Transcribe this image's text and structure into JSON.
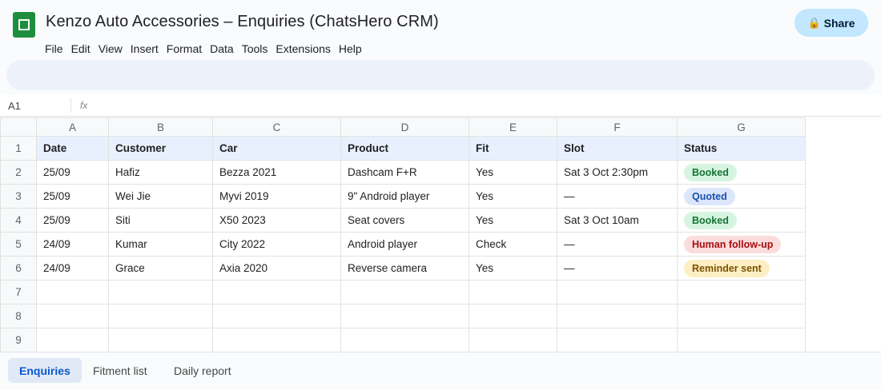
{
  "header": {
    "title": "Kenzo Auto Accessories – Enquiries (ChatsHero CRM)",
    "share_label": "Share",
    "share_icon": "lock-icon",
    "menu": [
      "File",
      "Edit",
      "View",
      "Insert",
      "Format",
      "Data",
      "Tools",
      "Extensions",
      "Help"
    ]
  },
  "formula_bar": {
    "cell_ref": "A1",
    "fx": "fx"
  },
  "grid": {
    "columns": [
      "A",
      "B",
      "C",
      "D",
      "E",
      "F",
      "G"
    ],
    "rows": [
      [
        "Date",
        "Customer",
        "Car",
        "Product",
        "Fit",
        "Slot",
        "Status"
      ],
      [
        "25/09",
        "Hafiz",
        "Bezza 2021",
        "Dashcam F+R",
        "Yes",
        "Sat 3 Oct 2:30pm",
        "Booked"
      ],
      [
        "25/09",
        "Wei Jie",
        "Myvi 2019",
        "9\" Android player",
        "Yes",
        "—",
        "Quoted"
      ],
      [
        "25/09",
        "Siti",
        "X50 2023",
        "Seat covers",
        "Yes",
        "Sat 3 Oct 10am",
        "Booked"
      ],
      [
        "24/09",
        "Kumar",
        "City 2022",
        "Android player",
        "Check",
        "—",
        "Human follow-up"
      ],
      [
        "24/09",
        "Grace",
        "Axia 2020",
        "Reverse camera",
        "Yes",
        "—",
        "Reminder sent"
      ],
      [
        "",
        "",
        "",
        "",
        "",
        "",
        ""
      ],
      [
        "",
        "",
        "",
        "",
        "",
        "",
        ""
      ],
      [
        "",
        "",
        "",
        "",
        "",
        "",
        ""
      ]
    ],
    "row_numbers": [
      "1",
      "2",
      "3",
      "4",
      "5",
      "6",
      "7",
      "8",
      "9"
    ],
    "status_colors": {
      "Booked": {
        "bg": "#d6f5e0",
        "fg": "#137333"
      },
      "Quoted": {
        "bg": "#dbe6fb",
        "fg": "#1a4fa8"
      },
      "Human follow-up": {
        "bg": "#fbdcdc",
        "fg": "#a50e0e"
      },
      "Reminder sent": {
        "bg": "#fdefc3",
        "fg": "#7a5200"
      }
    }
  },
  "tabs": [
    {
      "label": "Enquiries",
      "active": true
    },
    {
      "label": "Fitment list",
      "active": false
    },
    {
      "label": "Daily report",
      "active": false
    }
  ]
}
